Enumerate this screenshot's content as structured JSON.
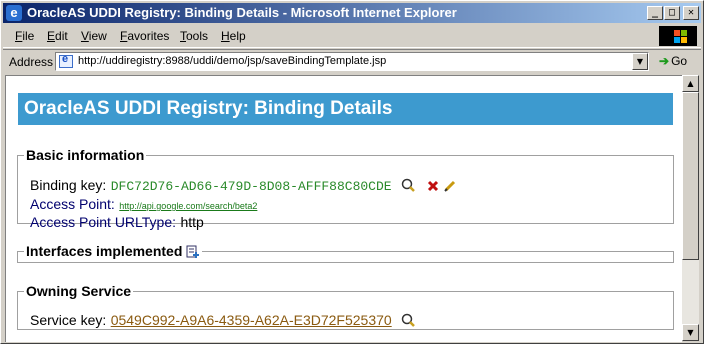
{
  "window": {
    "title": "OracleAS UDDI Registry: Binding Details - Microsoft Internet Explorer",
    "min_glyph": "_",
    "max_glyph": "□",
    "close_glyph": "✕"
  },
  "menu": {
    "items": [
      "File",
      "Edit",
      "View",
      "Favorites",
      "Tools",
      "Help"
    ]
  },
  "address": {
    "label": "Address",
    "url": "http://uddiregistry:8988/uddi/demo/jsp/saveBindingTemplate.jsp",
    "go_label": "Go",
    "dropdown_glyph": "▼"
  },
  "page": {
    "heading": "OracleAS UDDI Registry: Binding Details",
    "basic": {
      "legend": "Basic information",
      "binding_key_label": "Binding key:",
      "binding_key_value": "DFC72D76-AD66-479D-8D08-AFFF88C80CDE",
      "access_point_label": "Access Point:",
      "access_point_value": "http://api.google.com/search/beta2",
      "urltype_label": "Access Point URLType:",
      "urltype_value": "http"
    },
    "interfaces": {
      "legend": "Interfaces implemented"
    },
    "owning": {
      "legend": "Owning Service",
      "service_key_label": "Service key:",
      "service_key_value": "0549C992-A9A6-4359-A62A-E3D72F525370"
    }
  },
  "scrollbar": {
    "up_glyph": "▲",
    "down_glyph": "▼"
  },
  "colors": {
    "title_start": "#0a246a",
    "title_end": "#a6caf0",
    "header_bg": "#3d9acf",
    "binding_key": "#2a8a2a",
    "label_blue": "#00006e",
    "service_link": "#8a5a10"
  },
  "icons": [
    "ie-icon",
    "minimize-icon",
    "maximize-icon",
    "close-icon",
    "windows-logo-icon",
    "page-icon",
    "go-arrow-icon",
    "search-icon",
    "delete-icon",
    "edit-icon",
    "add-interface-icon"
  ]
}
